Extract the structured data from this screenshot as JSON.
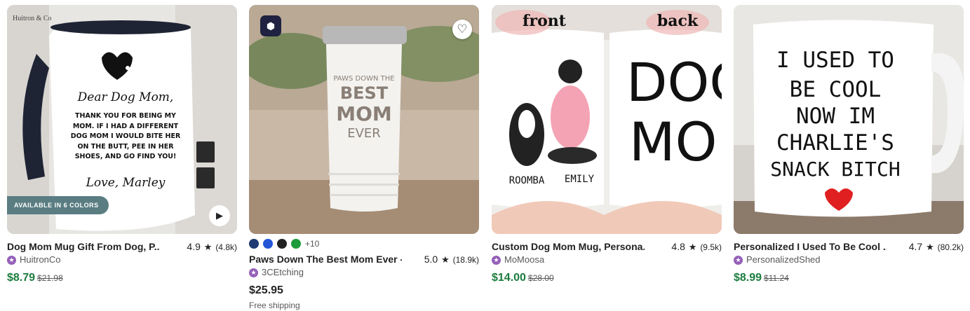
{
  "cards": [
    {
      "title": "Dog Mom Mug Gift From Dog, P...",
      "rating": "4.9",
      "count": "(4.8k)",
      "seller": "HuitronCo",
      "price": "$8.79",
      "original_price": "$21.98",
      "image_brand": "Huitron & Co",
      "image_pill": "AVAILABLE IN 6 COLORS",
      "mug_heading": "Dear Dog Mom,",
      "mug_body": "THANK YOU FOR BEING MY MOM. IF I HAD A DIFFERENT DOG MOM I WOULD BITE HER ON THE BUTT, PEE IN HER SHOES, AND GO FIND YOU!",
      "mug_signoff": "Love, Marley"
    },
    {
      "title": "Paws Down The Best Mom Ever -...",
      "rating": "5.0",
      "count": "(18.9k)",
      "seller": "3CEtching",
      "price": "$25.95",
      "shipping": "Free shipping",
      "more_colors": "+10",
      "swatch_colors": [
        "#1f3b73",
        "#2456d6",
        "#222222",
        "#1e9b3a"
      ],
      "tumbler_line1": "PAWS DOWN THE",
      "tumbler_line2": "BEST",
      "tumbler_line3": "MOM",
      "tumbler_line4": "EVER"
    },
    {
      "title": "Custom Dog Mom Mug, Persona...",
      "rating": "4.8",
      "count": "(9.5k)",
      "seller": "MoMoosa",
      "price": "$14.00",
      "original_price": "$28.00",
      "label_front": "front",
      "label_back": "back",
      "name_dog": "ROOMBA",
      "name_person": "EMILY",
      "mug_big1": "DOG",
      "mug_big2": "MOM"
    },
    {
      "title": "Personalized I Used To Be Cool ...",
      "rating": "4.7",
      "count": "(80.2k)",
      "seller": "PersonalizedShed",
      "price": "$8.99",
      "original_price": "$11.24",
      "mug_lines": [
        "I USED TO",
        "BE COOL",
        "NOW IM",
        "CHARLIE'S",
        "SNACK BITCH"
      ]
    }
  ],
  "colors": {
    "price_sale": "#1b7c3d",
    "star_seller_badge": "#9560b8"
  },
  "icons": {
    "rating": "star-icon",
    "favorite": "heart-icon",
    "video": "play-icon"
  }
}
